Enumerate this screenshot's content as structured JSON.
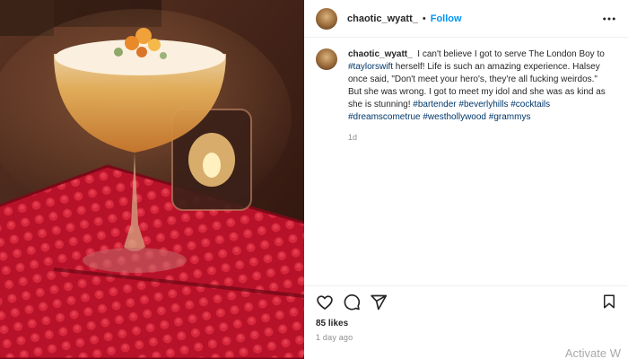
{
  "post": {
    "photo_alt": "",
    "header": {
      "username": "chaotic_wyatt_",
      "separator": "•",
      "follow_label": "Follow",
      "more_icon": "more-options-icon"
    },
    "caption": {
      "username": "chaotic_wyatt_",
      "part1": "I can't believe I got to serve The London Boy to ",
      "tag1": "#taylorswift",
      "part2": " herself! Life is such an amazing experience. Halsey once said, \"Don't meet your hero's, they're all fucking weirdos.\" But she was wrong. I got to meet my idol and she was as kind as she is stunning! ",
      "tag2": "#bartender",
      "tag3": "#beverlyhills",
      "tag4": "#cocktails",
      "tag5": "#dreamscometrue",
      "tag6": "#westhollywood",
      "tag7": "#grammys",
      "time": "1d"
    },
    "actions": {
      "like_icon": "heart-icon",
      "comment_icon": "comment-icon",
      "share_icon": "share-icon",
      "save_icon": "bookmark-icon"
    },
    "likes": "85 likes",
    "posted": "1 day ago"
  },
  "overlay": {
    "watermark": "Activate W"
  },
  "colors": {
    "accent": "#0095f6",
    "hashtag": "#00376b",
    "secondary_text": "#8e8e8e"
  }
}
